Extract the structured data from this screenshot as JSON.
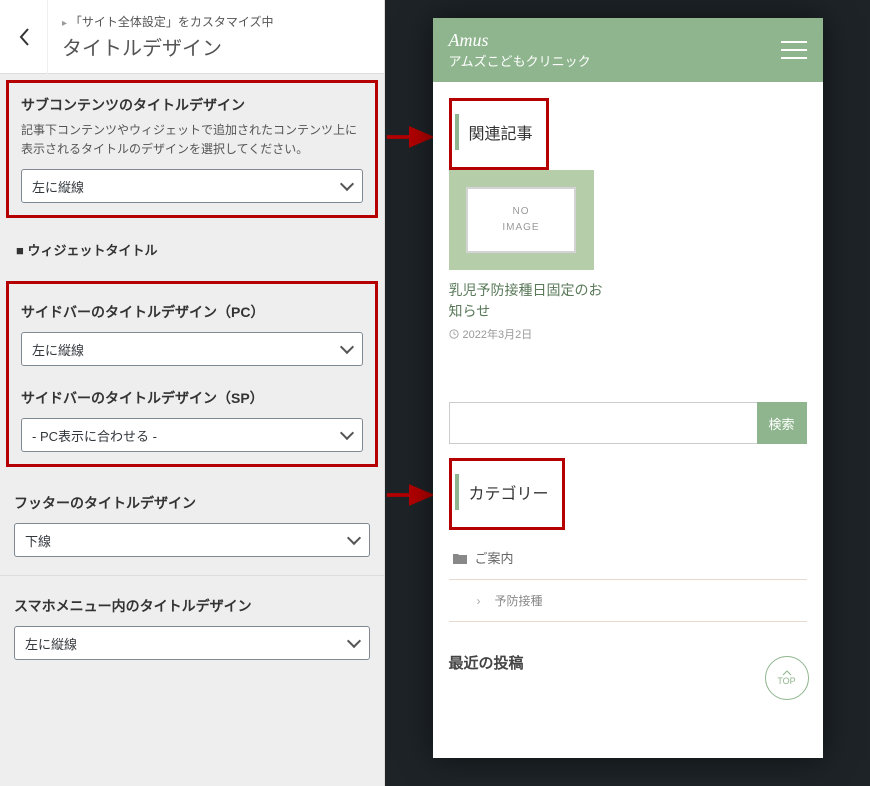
{
  "customizer": {
    "breadcrumb": "「サイト全体設定」をカスタマイズ中",
    "page_title": "タイトルデザイン",
    "sub_content": {
      "title": "サブコンテンツのタイトルデザイン",
      "desc": "記事下コンテンツやウィジェットで追加されたコンテンツ上に表示されるタイトルのデザインを選択してください。",
      "value": "左に縦線"
    },
    "widget_heading": "ウィジェットタイトル",
    "sidebar_pc": {
      "title": "サイドバーのタイトルデザイン（PC）",
      "value": "左に縦線"
    },
    "sidebar_sp": {
      "title": "サイドバーのタイトルデザイン（SP）",
      "value": "- PC表示に合わせる -"
    },
    "footer": {
      "title": "フッターのタイトルデザイン",
      "value": "下線"
    },
    "sp_menu": {
      "title": "スマホメニュー内のタイトルデザイン",
      "value": "左に縦線"
    }
  },
  "preview": {
    "brand_script": "Amus",
    "brand_jp": "アムズこどもクリニック",
    "related_heading": "関連記事",
    "no_image": "NO\nIMAGE",
    "post_title": "乳児予防接種日固定のお知らせ",
    "post_date": "2022年3月2日",
    "search_btn": "検索",
    "category_heading": "カテゴリー",
    "cat_items": [
      "ご案内",
      "予防接種"
    ],
    "recent_heading": "最近の投稿",
    "top_label": "TOP"
  }
}
